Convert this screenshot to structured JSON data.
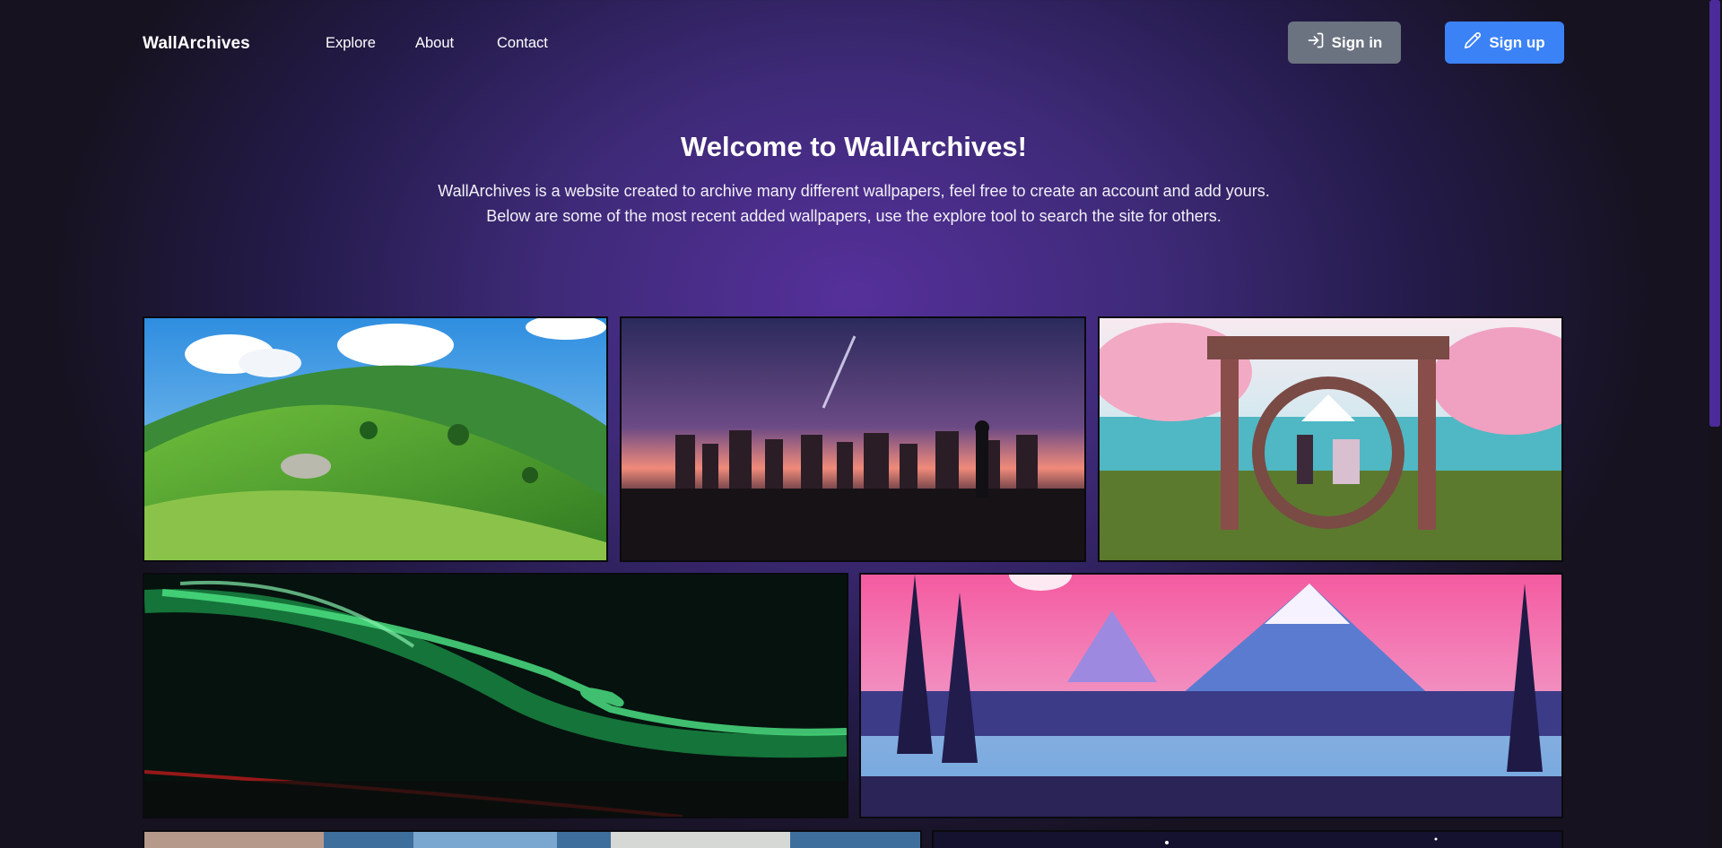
{
  "nav": {
    "brand": "WallArchives",
    "links": [
      "Explore",
      "About",
      "Contact"
    ],
    "sign_in": "Sign in",
    "sign_up": "Sign up",
    "sign_in_icon": "sign-in-icon",
    "sign_up_icon": "pencil-icon"
  },
  "hero": {
    "title": "Welcome to WallArchives!",
    "line1": "WallArchives is a website created to archive many different wallpapers, feel free to create an account and add yours.",
    "line2": "Below are some of the most recent added wallpapers, use the explore tool to search the site for others."
  },
  "colors": {
    "accent": "#3b82f6",
    "secondary_button": "#6b7280",
    "background": "#3e2a78"
  }
}
